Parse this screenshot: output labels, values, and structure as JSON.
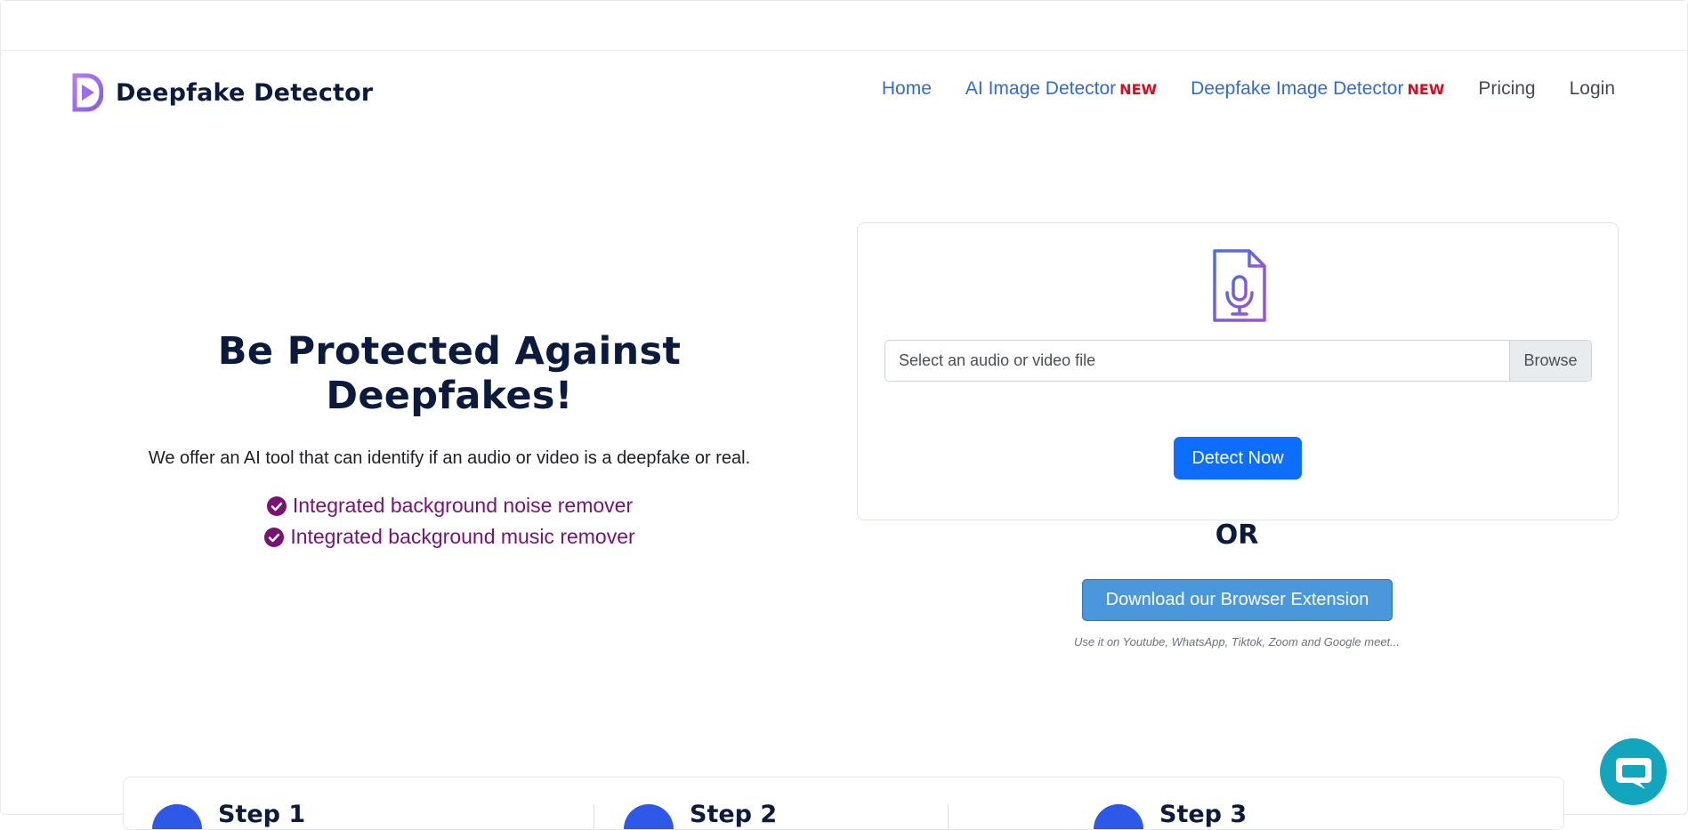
{
  "brand": {
    "name": "Deepfake Detector",
    "accent": "#a46af0"
  },
  "nav": {
    "items": [
      {
        "label": "Home",
        "badge": ""
      },
      {
        "label": "AI Image Detector",
        "badge": "NEW"
      },
      {
        "label": "Deepfake Image Detector",
        "badge": "NEW"
      },
      {
        "label": "Pricing",
        "badge": ""
      },
      {
        "label": "Login",
        "badge": ""
      }
    ]
  },
  "hero": {
    "title": "Be Protected Against Deepfakes!",
    "subtitle": "We offer an AI tool that can identify if an audio or video is a deepfake or real.",
    "features": [
      "Integrated background noise remover",
      "Integrated background music remover"
    ]
  },
  "upload": {
    "icon": "microphone-file-icon",
    "placeholder": "Select an audio or video file",
    "browse_label": "Browse",
    "detect_label": "Detect Now"
  },
  "or_label": "OR",
  "extension": {
    "button_label": "Download our Browser Extension",
    "note": "Use it on Youtube, WhatsApp, Tiktok, Zoom and Google meet..."
  },
  "steps": [
    "Step 1",
    "Step 2",
    "Step 3"
  ],
  "colors": {
    "primary": "#0d6efd",
    "nav_link": "#2f6bd8",
    "badge_new": "#e0081b",
    "feature_text": "#7a1177",
    "extension_button": "#4b97dc",
    "chat_button": "#12a5bd"
  }
}
